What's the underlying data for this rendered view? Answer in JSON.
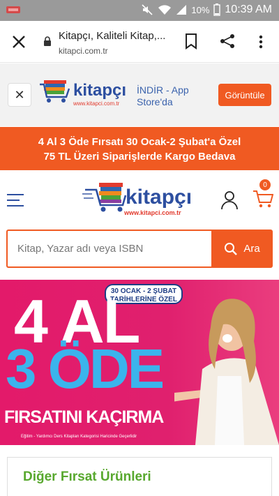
{
  "status_bar": {
    "battery_pct": "10%",
    "time": "10:39 AM"
  },
  "browser": {
    "title": "Kitapçı, Kaliteli Kitap,...",
    "url": "kitapci.com.tr"
  },
  "app_banner": {
    "logo_text": "kitapçı",
    "logo_url": "www.kitapci.com.tr",
    "indir_text": "İNDİR - App Store'da",
    "button": "Görüntüle"
  },
  "promo": {
    "line1": "4 Al 3 Öde Fırsatı 30 Ocak-2 Şubat'a Özel",
    "line2": "75 TL Üzeri Siparişlerde Kargo Bedava"
  },
  "header": {
    "logo_text": "kitapçı",
    "logo_url": "www.kitapci.com.tr",
    "cart_count": "0"
  },
  "search": {
    "placeholder": "Kitap, Yazar adı veya ISBN",
    "button": "Ara"
  },
  "hero": {
    "badge_line1": "30 OCAK - 2 ŞUBAT",
    "badge_line2": "TARİHLERİNE ÖZEL",
    "big_line1": "4 AL",
    "big_line2": "3 ÖDE",
    "cta": "FIRSATINI KAÇIRMA",
    "note": "Eğitim - Yardımcı Ders Kitapları Kategorisi Haricinde Geçerlidir"
  },
  "section": {
    "title": "Diğer Fırsat Ürünleri"
  }
}
